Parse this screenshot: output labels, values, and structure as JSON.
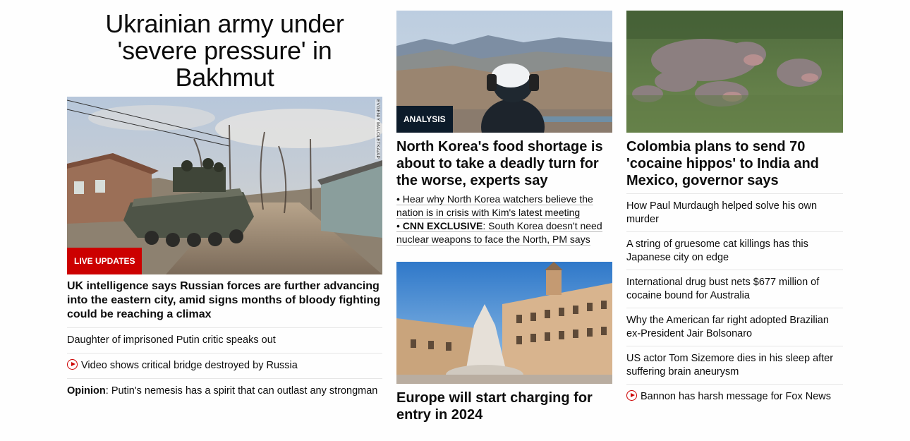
{
  "left": {
    "hero_title": "Ukrainian army under 'severe pressure' in Bakhmut",
    "image_credit": "EVGENIY MALOLETKA/AP",
    "badge": "LIVE UPDATES",
    "headline": "UK intelligence says Russian forces are further advancing into the eastern city, amid signs months of bloody fighting could be reaching a climax",
    "links": [
      {
        "text": "Daughter of imprisoned Putin critic speaks out"
      },
      {
        "text": "Video shows critical bridge destroyed by Russia"
      },
      {
        "prefix": "Opinion",
        "text": ": Putin's nemesis has a spirit that can outlast any strongman"
      }
    ]
  },
  "middle": {
    "card1": {
      "badge": "ANALYSIS",
      "headline": "North Korea's food shortage is about to take a deadly turn for the worse, experts say",
      "sub_links": [
        {
          "text": "Hear why North Korea watchers believe the nation is in crisis with Kim's latest meeting"
        },
        {
          "prefix": "CNN EXCLUSIVE",
          "text": ": South Korea doesn't need nuclear weapons to face the North, PM says"
        }
      ]
    },
    "card2": {
      "headline": "Europe will start charging for entry in 2024"
    }
  },
  "right": {
    "headline": "Colombia plans to send 70 'cocaine hippos' to India and Mexico, governor says",
    "links": [
      {
        "text": "How Paul Murdaugh helped solve his own murder"
      },
      {
        "text": "A string of gruesome cat killings has this Japanese city on edge"
      },
      {
        "text": "International drug bust nets $677 million of cocaine bound for Australia"
      },
      {
        "text": "Why the American far right adopted Brazilian ex-President Jair Bolsonaro"
      },
      {
        "text": "US actor Tom Sizemore dies in his sleep after suffering brain aneurysm"
      },
      {
        "text": "Bannon has harsh message for Fox News"
      }
    ]
  },
  "colors": {
    "live_badge": "#cc0000",
    "analysis_badge": "#0c1b2a",
    "text": "#0c0c0c",
    "divider": "#e6e6e6"
  },
  "icons": {
    "video": "play-circle-icon"
  }
}
